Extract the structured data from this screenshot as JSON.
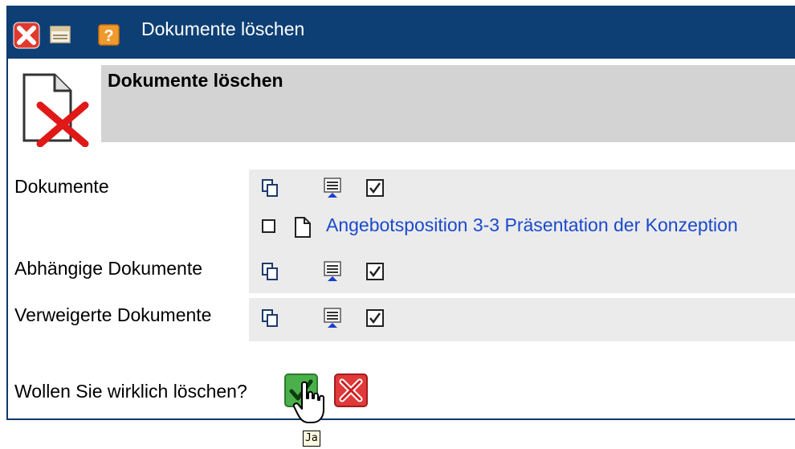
{
  "window": {
    "title": "Dokumente löschen"
  },
  "header": {
    "title": "Dokumente löschen"
  },
  "rows": [
    {
      "label": "Dokumente"
    },
    {
      "label": "Abhängige Dokumente"
    },
    {
      "label": "Verweigerte Dokumente"
    }
  ],
  "documents": [
    {
      "name": "Angebotsposition 3-3 Präsentation der Konzeption",
      "checked": false
    }
  ],
  "confirm": {
    "question": "Wollen Sie wirklich löschen?",
    "tooltip": "Ja"
  },
  "colors": {
    "titlebar": "#0d3f74",
    "link": "#1a4acc",
    "row_bg": "#ebebeb",
    "header_bg": "#d3d3d3"
  },
  "icons": [
    "close-icon",
    "minimize-icon",
    "help-icon",
    "delete-document-icon",
    "copy-icon",
    "select-list-icon",
    "checkbox-icon",
    "document-icon",
    "confirm-yes-icon",
    "confirm-no-icon",
    "hand-cursor-icon"
  ]
}
